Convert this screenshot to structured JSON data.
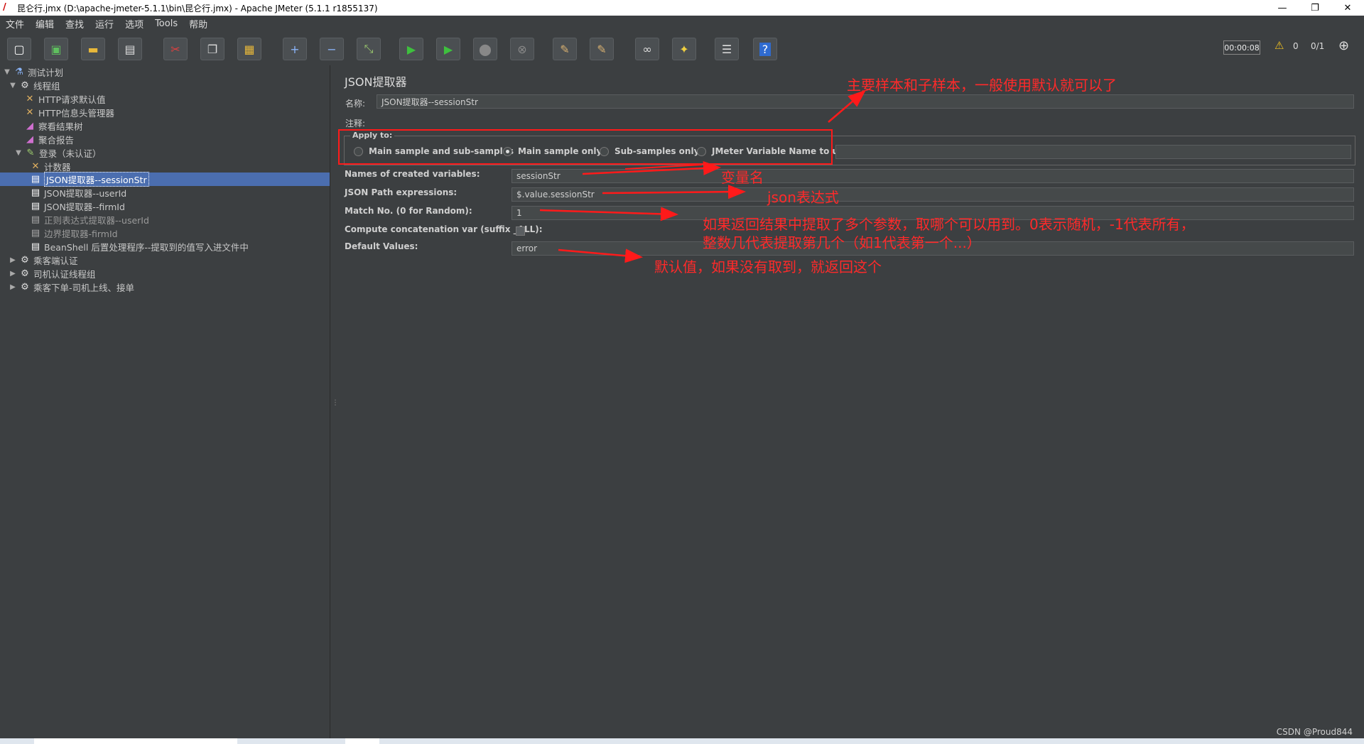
{
  "window": {
    "title": "昆仑行.jmx (D:\\apache-jmeter-5.1.1\\bin\\昆仑行.jmx) - Apache JMeter (5.1.1 r1855137)",
    "min": "—",
    "max": "❐",
    "close": "✕"
  },
  "menu": [
    "文件",
    "编辑",
    "查找",
    "运行",
    "选项",
    "Tools",
    "帮助"
  ],
  "toolbar": {
    "timer": "00:00:08",
    "warn_count": "0",
    "threads": "0/1"
  },
  "tree": [
    {
      "label": "测试计划",
      "icon": "test-plan-icon"
    },
    {
      "label": "线程组",
      "icon": "gear-icon"
    },
    {
      "label": "HTTP请求默认值",
      "icon": "tools-icon"
    },
    {
      "label": "HTTP信息头管理器",
      "icon": "tools-icon"
    },
    {
      "label": "察看结果树",
      "icon": "chart-icon"
    },
    {
      "label": "聚合报告",
      "icon": "chart-icon"
    },
    {
      "label": "登录（未认证）",
      "icon": "pen-icon"
    },
    {
      "label": "计数器",
      "icon": "tools-icon"
    },
    {
      "label": "JSON提取器--sessionStr",
      "icon": "doc-icon"
    },
    {
      "label": "JSON提取器--userId",
      "icon": "doc-icon"
    },
    {
      "label": "JSON提取器--firmId",
      "icon": "doc-icon"
    },
    {
      "label": "正则表达式提取器--userId",
      "icon": "doc-icon"
    },
    {
      "label": "边界提取器-firmId",
      "icon": "doc-icon"
    },
    {
      "label": "BeanShell 后置处理程序--提取到的值写入进文件中",
      "icon": "doc-icon"
    },
    {
      "label": "乘客端认证",
      "icon": "gear-icon"
    },
    {
      "label": "司机认证线程组",
      "icon": "gear-icon"
    },
    {
      "label": "乘客下单-司机上线、接单",
      "icon": "gear-icon"
    }
  ],
  "panel": {
    "title": "JSON提取器",
    "name_label": "名称:",
    "name_value": "JSON提取器--sessionStr",
    "comment_label": "注释:",
    "apply_to": {
      "legend": "Apply to:",
      "options": [
        "Main sample and sub-samples",
        "Main sample only",
        "Sub-samples only",
        "JMeter Variable Name to use"
      ],
      "selected": "Main sample only"
    },
    "var_names_label": "Names of created variables:",
    "var_names_value": "sessionStr",
    "json_path_label": "JSON Path expressions:",
    "json_path_value": "$.value.sessionStr",
    "match_no_label": "Match No. (0 for Random):",
    "match_no_value": "1",
    "concat_label": "Compute concatenation var (suffix _ALL):",
    "default_label": "Default Values:",
    "default_value": "error"
  },
  "annotations": {
    "apply_to": "主要样本和子样本，一般使用默认就可以了",
    "var_name": "变量名",
    "json_expr": "json表达式",
    "match_no_1": "如果返回结果中提取了多个参数，取哪个可以用到。0表示随机，-1代表所有，",
    "match_no_2": "整数几代表提取第几个（如1代表第一个...）",
    "default": "默认值，如果没有取到，就返回这个"
  },
  "watermark": "CSDN @Proud844"
}
